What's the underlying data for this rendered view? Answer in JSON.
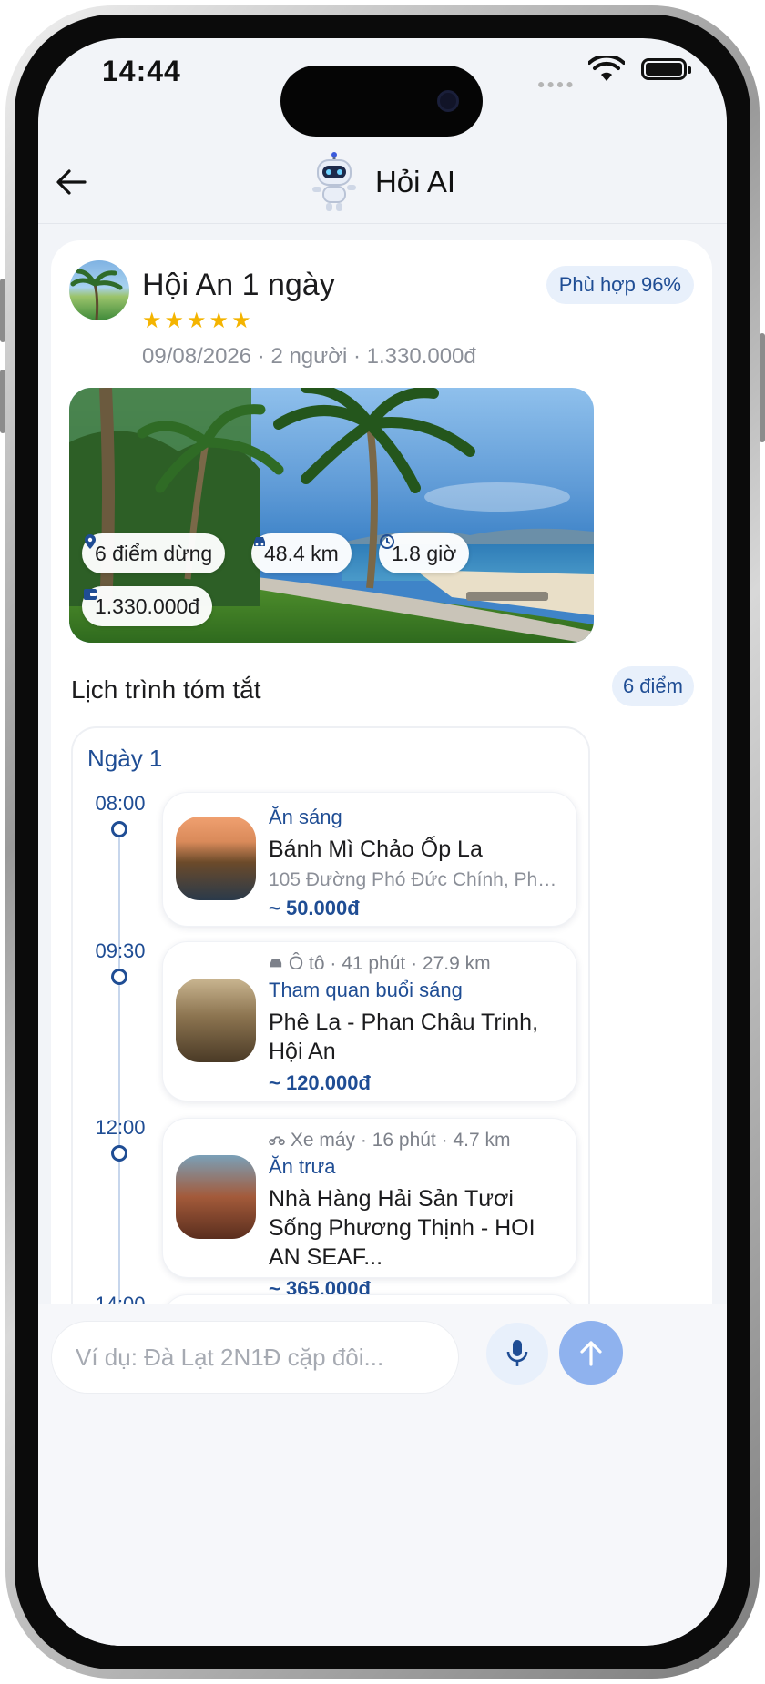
{
  "status_bar": {
    "time": "14:44"
  },
  "header": {
    "title": "Hỏi AI"
  },
  "trip": {
    "title": "Hội An 1 ngày",
    "rating_stars": "★★★★★",
    "rating": 5,
    "meta": "09/08/2026 · 2 người · 1.330.000đ",
    "match": "Phù hợp 96%",
    "chips": {
      "stops": "6 điểm dừng",
      "distance": "48.4 km",
      "duration": "1.8 giờ",
      "cost": "1.330.000đ"
    }
  },
  "itinerary": {
    "title": "Lịch trình tóm tắt",
    "count": "6 điểm",
    "day_label": "Ngày 1",
    "stops": [
      {
        "time": "08:00",
        "category": "Ăn sáng",
        "name": "Bánh Mì Chảo Ốp La",
        "address": "105 Đường Phó Đức Chính, Phư...",
        "price": "~ 50.000đ"
      },
      {
        "time": "09:30",
        "travel": "Ô tô · 41 phút · 27.9 km",
        "category": "Tham quan buổi sáng",
        "name": "Phê La - Phan Châu Trinh, Hội An",
        "price": "~ 120.000đ"
      },
      {
        "time": "12:00",
        "travel": "Xe máy · 16 phút · 4.7 km",
        "category": "Ăn trưa",
        "name": "Nhà Hàng Hải Sản Tươi Sống Phương Thịnh - HOI AN SEAF...",
        "price": "~ 365.000đ"
      },
      {
        "time": "14:00"
      }
    ]
  },
  "composer": {
    "placeholder": "Ví dụ: Đà Lạt 2N1Đ cặp đôi..."
  },
  "colors": {
    "accent": "#1f4d94",
    "badge_bg": "#e8f0fb",
    "star": "#f4b400",
    "send": "#8fb2ee"
  }
}
